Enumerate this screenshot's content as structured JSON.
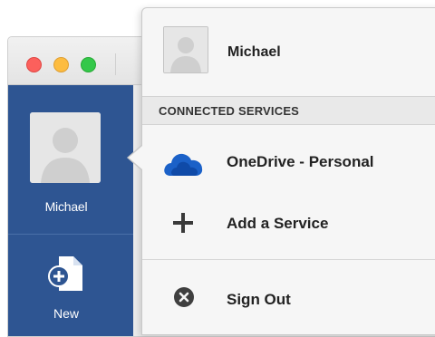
{
  "sidebar": {
    "user_name": "Michael",
    "new_label": "New"
  },
  "account_menu": {
    "user_name": "Michael",
    "section_header": "CONNECTED SERVICES",
    "items": [
      {
        "label": "OneDrive - Personal",
        "icon": "onedrive-icon"
      },
      {
        "label": "Add a Service",
        "icon": "plus-icon"
      },
      {
        "label": "Sign Out",
        "icon": "close-circle-icon"
      }
    ]
  },
  "colors": {
    "sidebar_bg": "#2e5592",
    "onedrive_blue": "#1b61c8",
    "close_red": "#fc605c",
    "minimize_yellow": "#fdbc40",
    "zoom_green": "#34c84a"
  }
}
